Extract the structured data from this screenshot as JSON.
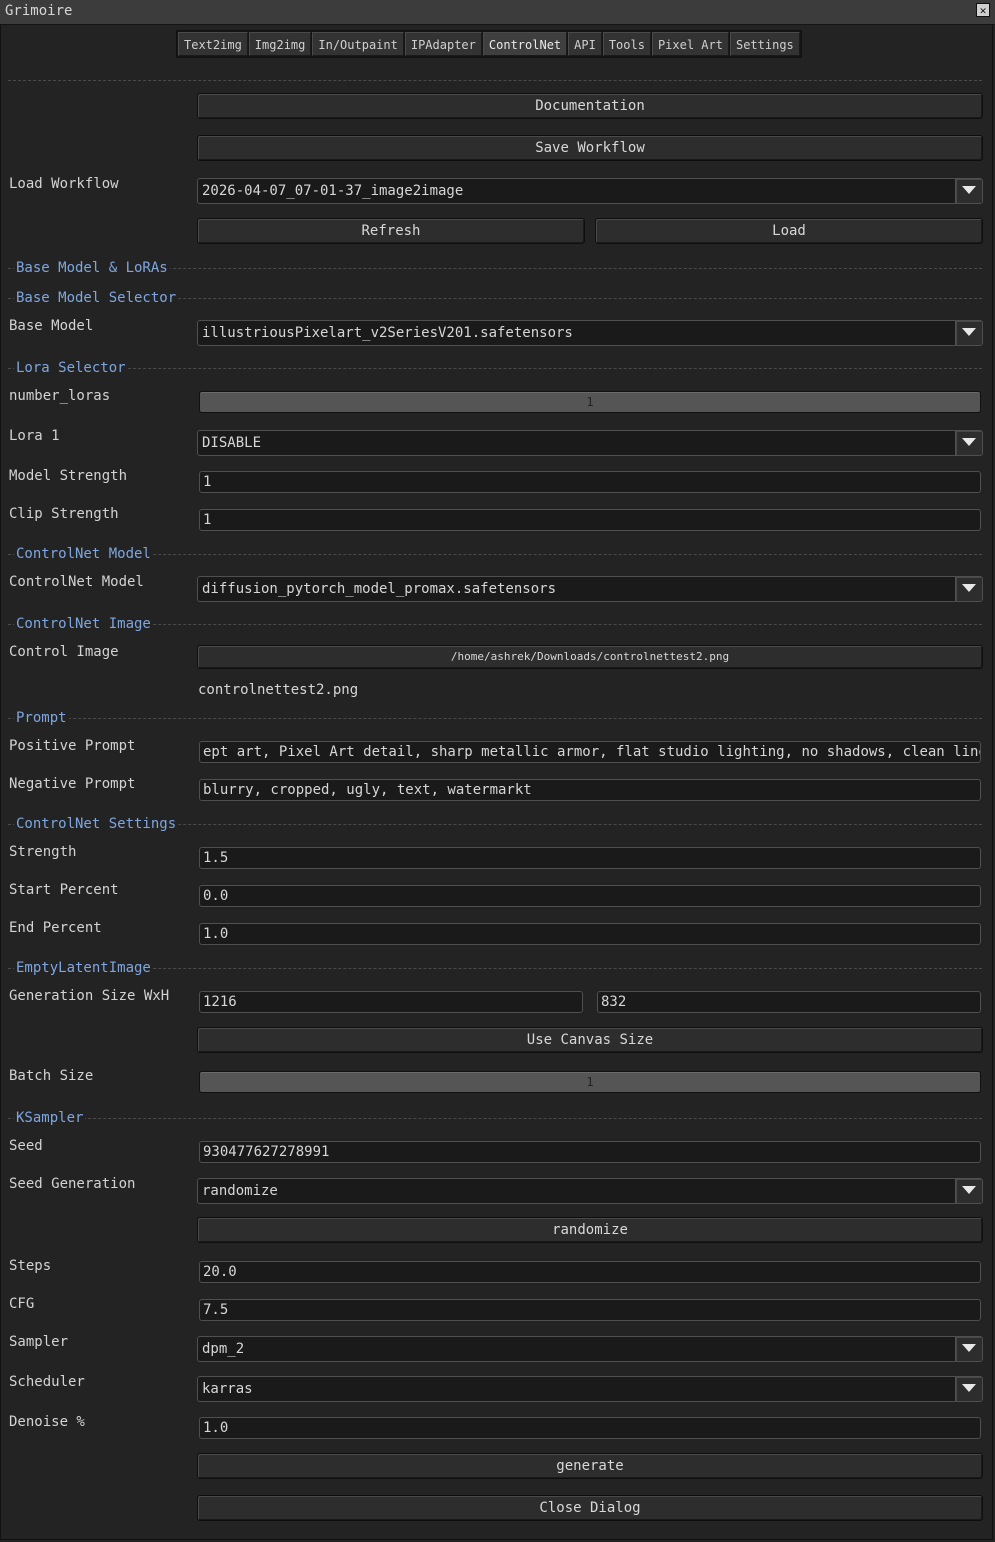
{
  "window": {
    "title": "Grimoire"
  },
  "tabs": [
    "Text2img",
    "Img2img",
    "In/Outpaint",
    "IPAdapter",
    "ControlNet",
    "API",
    "Tools",
    "Pixel Art",
    "Settings"
  ],
  "active_tab": "ControlNet",
  "workflow": {
    "documentation_label": "Documentation",
    "save_label": "Save Workflow",
    "load_workflow_label": "Load Workflow",
    "load_workflow_value": "2026-04-07_07-01-37_image2image",
    "refresh_label": "Refresh",
    "load_label": "Load"
  },
  "sections": {
    "base_model_loras": "Base Model & LoRAs",
    "base_model_selector": "Base Model Selector",
    "lora_selector": "Lora Selector",
    "controlnet_model": "ControlNet Model",
    "controlnet_image": "ControlNet Image",
    "prompt": "Prompt",
    "controlnet_settings": "ControlNet Settings",
    "empty_latent": "EmptyLatentImage",
    "ksampler": "KSampler"
  },
  "base_model": {
    "label": "Base Model",
    "value": "illustriousPixelart_v2SeriesV201.safetensors"
  },
  "lora": {
    "number_label": "number_loras",
    "number_value": "1",
    "lora1_label": "Lora 1",
    "lora1_value": "DISABLE",
    "model_strength_label": "Model Strength",
    "model_strength_value": "1",
    "clip_strength_label": "Clip Strength",
    "clip_strength_value": "1"
  },
  "controlnet": {
    "model_label": "ControlNet Model",
    "model_value": "diffusion_pytorch_model_promax.safetensors",
    "image_label": "Control Image",
    "image_path": "/home/ashrek/Downloads/controlnettest2.png",
    "image_filename": "controlnettest2.png"
  },
  "prompt": {
    "positive_label": "Positive Prompt",
    "positive_value": "ept art, Pixel Art detail, sharp metallic armor, flat studio lighting, no shadows, clean linewo",
    "negative_label": "Negative Prompt",
    "negative_value": "blurry, cropped, ugly, text, watermarkt"
  },
  "cn_settings": {
    "strength_label": "Strength",
    "strength_value": "1.5",
    "start_label": "Start Percent",
    "start_value": "0.0",
    "end_label": "End Percent",
    "end_value": "1.0"
  },
  "latent": {
    "size_label": "Generation Size WxH",
    "width": "1216",
    "height": "832",
    "canvas_label": "Use Canvas Size",
    "batch_label": "Batch Size",
    "batch_value": "1"
  },
  "ksampler": {
    "seed_label": "Seed",
    "seed_value": "930477627278991",
    "seedgen_label": "Seed Generation",
    "seedgen_value": "randomize",
    "randomize_label": "randomize",
    "steps_label": "Steps",
    "steps_value": "20.0",
    "cfg_label": "CFG",
    "cfg_value": "7.5",
    "sampler_label": "Sampler",
    "sampler_value": "dpm_2",
    "scheduler_label": "Scheduler",
    "scheduler_value": "karras",
    "denoise_label": "Denoise %",
    "denoise_value": "1.0"
  },
  "actions": {
    "generate_label": "generate",
    "close_label": "Close Dialog"
  },
  "colors": {
    "background": "#232323",
    "section_header": "#7ea6e0",
    "titlebar": "#3c3c3c"
  }
}
